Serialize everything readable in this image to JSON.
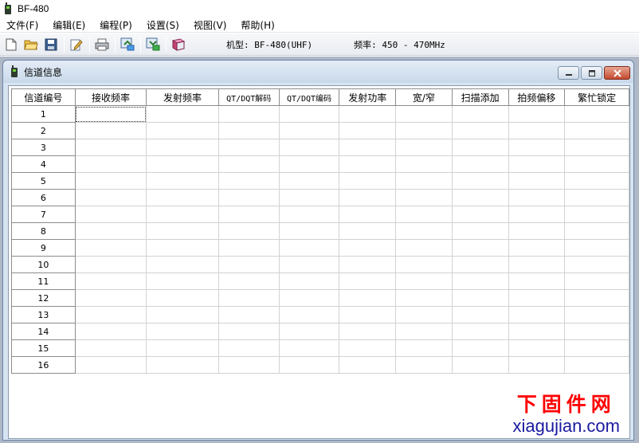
{
  "app": {
    "title": "BF-480"
  },
  "menu": [
    {
      "label": "文件(F)"
    },
    {
      "label": "编辑(E)"
    },
    {
      "label": "编程(P)"
    },
    {
      "label": "设置(S)"
    },
    {
      "label": "视图(V)"
    },
    {
      "label": "帮助(H)"
    }
  ],
  "toolbar": {
    "buttons": [
      "new-file-icon",
      "open-folder-icon",
      "save-icon",
      "edit-icon",
      "print-icon",
      "read-radio-icon",
      "write-radio-icon",
      "book-icon"
    ],
    "model_label": "机型: BF-480(UHF)",
    "freq_label": "频率: 450 - 470MHz"
  },
  "child_window": {
    "title": "信道信息",
    "columns": [
      "信道编号",
      "接收频率",
      "发射频率",
      "QT/DQT解码",
      "QT/DQT编码",
      "发射功率",
      "宽/窄",
      "扫描添加",
      "拍频偏移",
      "繁忙锁定"
    ],
    "rows": [
      "1",
      "2",
      "3",
      "4",
      "5",
      "6",
      "7",
      "8",
      "9",
      "10",
      "11",
      "12",
      "13",
      "14",
      "15",
      "16"
    ]
  },
  "watermark": {
    "cn": "下固件网",
    "en": "xiagujian.com"
  },
  "colors": {
    "mdi_background": "#aeb8c6",
    "grid_border": "#8c8c8c",
    "watermark_red": "#ff0000",
    "watermark_blue": "#1a1aa0"
  }
}
